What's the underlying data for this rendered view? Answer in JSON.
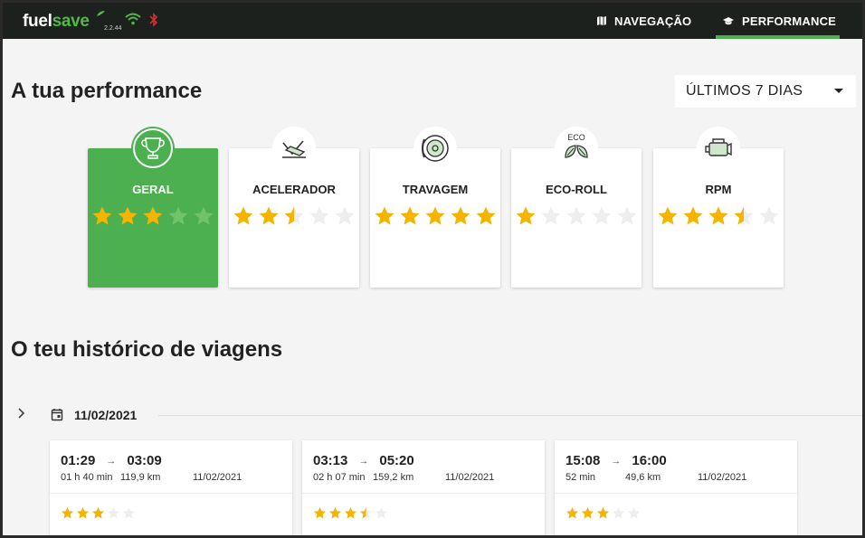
{
  "app": {
    "logo_part1": "fuel",
    "logo_part2": "save",
    "version": "2.2.44"
  },
  "nav": {
    "tabs": [
      {
        "label": "NAVEGAÇÃO",
        "icon": "map-icon",
        "active": false
      },
      {
        "label": "PERFORMANCE",
        "icon": "graduation-cap-icon",
        "active": true
      }
    ]
  },
  "performance": {
    "title": "A tua performance",
    "period": "ÚLTIMOS 7 DIAS",
    "categories": [
      {
        "label": "GERAL",
        "rating": 3,
        "max": 5,
        "icon": "trophy-icon",
        "active": true
      },
      {
        "label": "ACELERADOR",
        "rating": 2.5,
        "max": 5,
        "icon": "accelerator-pedal-icon",
        "active": false
      },
      {
        "label": "TRAVAGEM",
        "rating": 5,
        "max": 5,
        "icon": "brake-disc-icon",
        "active": false
      },
      {
        "label": "ECO-ROLL",
        "rating": 1,
        "max": 5,
        "icon": "eco-leaves-icon",
        "icon_text": "ECO",
        "active": false
      },
      {
        "label": "RPM",
        "rating": 3.5,
        "max": 5,
        "icon": "engine-icon",
        "active": false
      }
    ]
  },
  "history": {
    "title": "O teu histórico de viagens",
    "date": "11/02/2021",
    "trips": [
      {
        "start": "01:29",
        "end": "03:09",
        "duration": "01 h 40 min",
        "distance": "119,9 km",
        "date": "11/02/2021",
        "rating": 3
      },
      {
        "start": "03:13",
        "end": "05:20",
        "duration": "02 h 07 min",
        "distance": "159,2 km",
        "date": "11/02/2021",
        "rating": 3.5
      },
      {
        "start": "15:08",
        "end": "16:00",
        "duration": "52 min",
        "distance": "49,6 km",
        "date": "11/02/2021",
        "rating": 3
      }
    ]
  },
  "colors": {
    "accent": "#4caf50",
    "star": "#f5b400",
    "star_empty": "#eeeeee",
    "topbar": "#1c211e"
  }
}
